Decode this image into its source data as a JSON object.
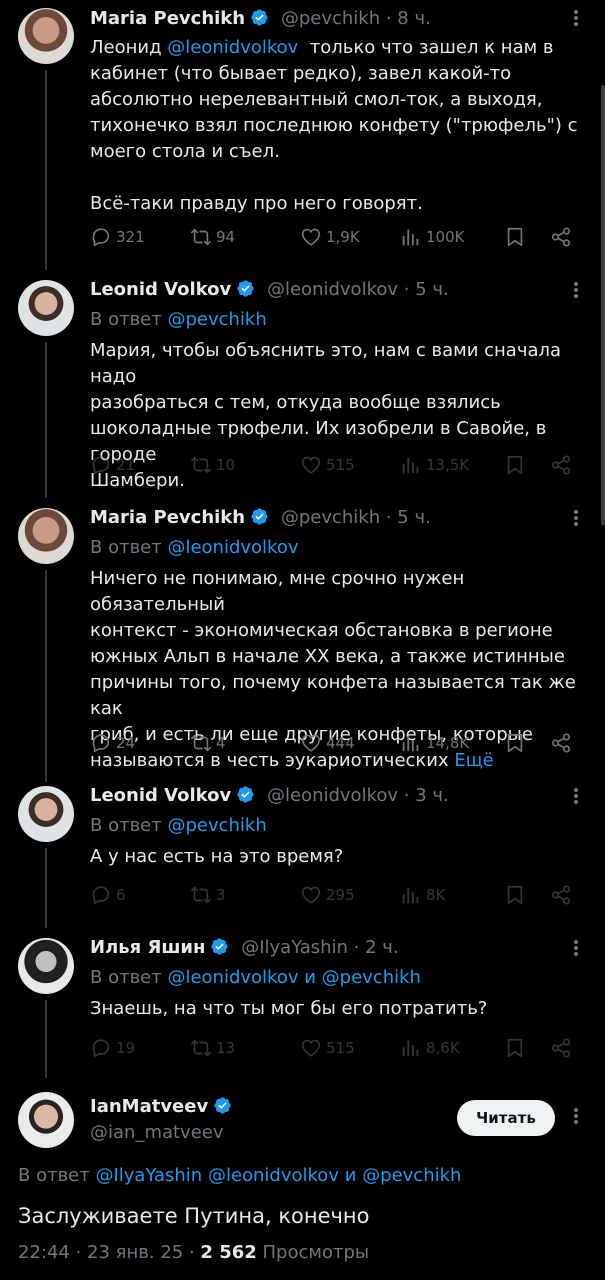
{
  "tweets": [
    {
      "name": "Maria Pevchikh",
      "handle": "@pevchikh",
      "time": "8 ч.",
      "text_before": "Леонид ",
      "text_link": "@leonidvolkov",
      "text_after": "  только что зашел к нам в\nкабинет (что бывает редко), завел какой-то\nабсолютно нерелевантный смол-ток, а выходя,\nтихонечко взял последнюю конфету (\"трюфель\") с\nмоего стола и съел.\n\nВсё-таки правду про него говорят.",
      "replies": "321",
      "reposts": "94",
      "likes": "1,9K",
      "views": "100K"
    },
    {
      "name": "Leonid Volkov",
      "handle": "@leonidvolkov",
      "time": "5 ч.",
      "reply_prefix": "В ответ ",
      "reply_to": "@pevchikh",
      "text": "Мария, чтобы объяснить это, нам с вами сначала надо\nразобраться с тем, откуда вообще взялись\nшоколадные трюфели. Их изобрели в Савойе, в городе\nШамбери.",
      "replies": "21",
      "reposts": "10",
      "likes": "515",
      "views": "13,5K"
    },
    {
      "name": "Maria Pevchikh",
      "handle": "@pevchikh",
      "time": "5 ч.",
      "reply_prefix": "В ответ ",
      "reply_to": "@leonidvolkov",
      "text": "Ничего не понимаю, мне срочно нужен обязательный\nконтекст - экономическая обстановка в регионе\nюжных Альп в начале XX века, а также истинные\nпричины того, почему конфета называется так же как\nгриб, и есть ли еще другие конфеты, которые\nназываются в честь эукариотических ",
      "more_link": "Ещё",
      "replies": "24",
      "reposts": "4",
      "likes": "444",
      "views": "14,8K"
    },
    {
      "name": "Leonid Volkov",
      "handle": "@leonidvolkov",
      "time": "3 ч.",
      "reply_prefix": "В ответ ",
      "reply_to": "@pevchikh",
      "text": "А у нас есть на это время?",
      "replies": "6",
      "reposts": "3",
      "likes": "295",
      "views": "8K"
    },
    {
      "name": "Илья Яшин",
      "handle": "@IlyaYashin",
      "time": "2 ч.",
      "reply_prefix": "В ответ ",
      "reply_to": "@leonidvolkov",
      "reply_and": " и ",
      "reply_to2": "@pevchikh",
      "text": "Знаешь, на что ты мог бы его потратить?",
      "replies": "19",
      "reposts": "13",
      "likes": "515",
      "views": "8,6K"
    }
  ],
  "main": {
    "name": "IanMatveev",
    "handle": "@ian_matveev",
    "follow_label": "Читать",
    "reply_prefix": "В ответ ",
    "reply_to1": "@IlyaYashin",
    "reply_to2": "@leonidvolkov",
    "reply_and": " и ",
    "reply_to3": "@pevchikh",
    "text": "Заслуживаете Путина, конечно",
    "time": "22:44",
    "date": "23 янв. 25",
    "views_count": "2 562",
    "views_label": "Просмотры"
  },
  "separator": " · ",
  "colors": {
    "accent": "#1d9bf0",
    "muted": "#71767b",
    "bg": "#000000"
  },
  "icons": [
    "verified-icon",
    "more-icon",
    "reply-icon",
    "repost-icon",
    "like-icon",
    "views-icon",
    "bookmark-icon",
    "share-icon"
  ]
}
